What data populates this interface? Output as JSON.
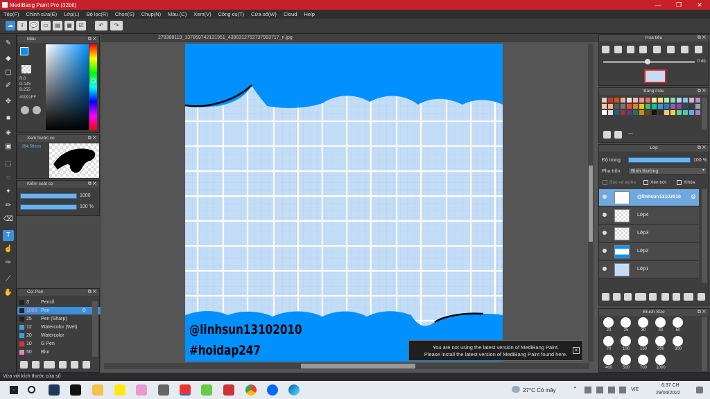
{
  "window": {
    "title": "MediBang Paint Pro (32bit)"
  },
  "menu": [
    "Tệp(F)",
    "Chỉnh sửa(E)",
    "Lớp(L)",
    "Bộ lọc(R)",
    "Chọn(S)",
    "Chụp(N)",
    "Màu (C)",
    "Xem(V)",
    "Công cụ(T)",
    "Cửa sổ(W)",
    "Cloud",
    "Help"
  ],
  "document": {
    "tab_title": "278388119_1378597421319​51_4390312752737993717_n.jpg"
  },
  "color_panel": {
    "title": "Màu",
    "r": "R:0",
    "g": "G:145",
    "b": "B:255",
    "hex": "#0091FF",
    "primary": "#0091ff"
  },
  "brush_preview": {
    "title": "Xem trước cọ",
    "size": "264.58mm"
  },
  "brush_control": {
    "title": "Kiểm soát cọ",
    "size_value": "1000",
    "opacity_value": "100 %"
  },
  "brush_list": {
    "title": "Cọ: Pen",
    "items": [
      {
        "size": "3",
        "name": "Pencil",
        "color": "#222222"
      },
      {
        "size": "1000",
        "name": "Pen",
        "color": "#222222"
      },
      {
        "size": "25",
        "name": "Pen (Sharp)",
        "color": "#222222"
      },
      {
        "size": "12",
        "name": "Watercolor (Wet)",
        "color": "#3aa0e0"
      },
      {
        "size": "20",
        "name": "Watercolor",
        "color": "#3aa0e0"
      },
      {
        "size": "10",
        "name": "G Pen",
        "color": "#e03030"
      },
      {
        "size": "50",
        "name": "Blur",
        "color": "#e088c0"
      }
    ]
  },
  "navigator": {
    "title": "Hoa tiêu",
    "angle": "0 độ"
  },
  "palette": {
    "title": "Bảng màu",
    "colors": [
      "#f4c7c3",
      "#c0392b",
      "#d35400",
      "#e6b0aa",
      "#fadbd8",
      "#f5b7b1",
      "#f1948a",
      "#ec7063",
      "#f9e79f",
      "#f7dc6f",
      "#abebc6",
      "#82e0aa",
      "#aed6f1",
      "#85c1e9",
      "#d2b4de",
      "#bb8fce",
      "#f5cba7",
      "#f0b27a",
      "#555555",
      "#777777",
      "#e74c3c",
      "#e67e22",
      "#f1c40f",
      "#2ecc71",
      "#1abc9c",
      "#3498db",
      "#2980b9",
      "#9b59b6",
      "#8e44ad",
      "#34495e",
      "#2c3e50",
      "#95a5a6",
      "#ffffff",
      "#dddddd",
      "#1f618d",
      "#a93226",
      "#6c3483",
      "#117864",
      "#b7950b",
      "#784212",
      "#111111",
      "#333333",
      "#f8c471",
      "#f4d03f",
      "#58d68d",
      "#48c9b0",
      "#5dade2",
      "#af7ac5"
    ],
    "add_label": "---"
  },
  "layers": {
    "title": "Lớp",
    "opacity_label": "Độ trong",
    "opacity_value": "100 %",
    "blend_label": "Pha trộn",
    "blend_value": "Bình thường",
    "protect_alpha": "Bảo vệ alpha",
    "clipping": "Xén bớt",
    "lock": "Khóa",
    "items": [
      {
        "name": "@linhsun13102010",
        "selected": true
      },
      {
        "name": "Lớp4",
        "selected": false
      },
      {
        "name": "Lớp3",
        "selected": false
      },
      {
        "name": "Lớp2",
        "selected": false
      },
      {
        "name": "Lớp1",
        "selected": false
      }
    ]
  },
  "brush_size": {
    "title": "Brush Size",
    "sizes": [
      "20",
      "25",
      "30",
      "40",
      "50",
      "70",
      "100",
      "150",
      "200",
      "300",
      "400",
      "500",
      "700",
      "1000"
    ]
  },
  "canvas": {
    "text1": "@linhsun13102010",
    "text2": "#hoidap247",
    "bg_color": "#c4ddf7",
    "cloud_color": "#0091ff"
  },
  "notice": {
    "line1": "You are not using the latest version of MediBang Paint.",
    "line2": "Please install the latest version of MediBang Paint found here."
  },
  "status": {
    "text": "Vừa với kích thước cửa sổ"
  },
  "taskbar": {
    "weather": "27°C  Có mây",
    "lang": "VIE",
    "time": "6:37 CH",
    "date": "29/04/2022"
  }
}
